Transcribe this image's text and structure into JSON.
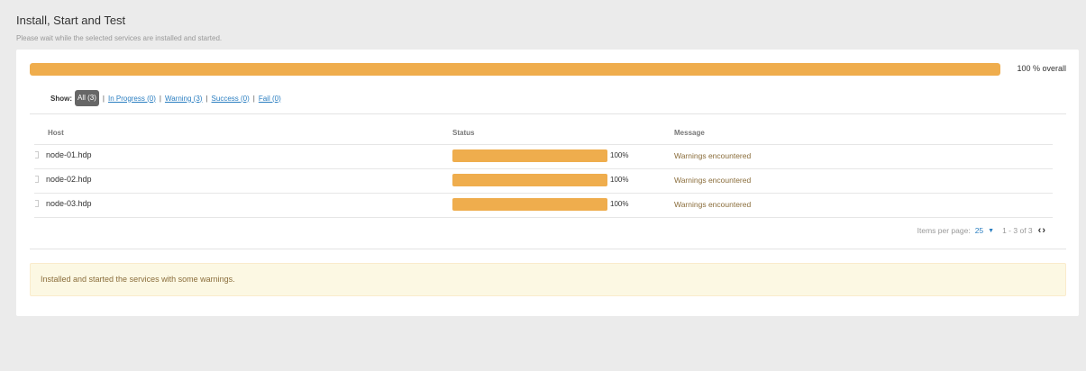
{
  "page": {
    "title": "Install, Start and Test",
    "subtitle": "Please wait while the selected services are installed and started."
  },
  "overall": {
    "progress_percent": 100,
    "label": "100 % overall"
  },
  "filters": {
    "show_label": "Show:",
    "items": [
      {
        "label": "All (3)",
        "active": true
      },
      {
        "label": "In Progress (0)",
        "active": false
      },
      {
        "label": "Warning (3)",
        "active": false
      },
      {
        "label": "Success (0)",
        "active": false
      },
      {
        "label": "Fail (0)",
        "active": false
      }
    ],
    "separator": "|"
  },
  "table": {
    "columns": [
      "Host",
      "Status",
      "Message"
    ],
    "rows": [
      {
        "host": "node-01.hdp",
        "progress": 100,
        "progress_label": "100%",
        "message": "Warnings encountered"
      },
      {
        "host": "node-02.hdp",
        "progress": 100,
        "progress_label": "100%",
        "message": "Warnings encountered"
      },
      {
        "host": "node-03.hdp",
        "progress": 100,
        "progress_label": "100%",
        "message": "Warnings encountered"
      }
    ]
  },
  "pagination": {
    "per_page_label": "Items per page:",
    "per_page_value": "25",
    "range": "1 - 3 of 3",
    "nav_icons": "chevron-left-right-icons"
  },
  "alert": {
    "text": "Installed and started the services with some warnings.",
    "type": "warning"
  },
  "colors": {
    "progress_warning": "#efad4d",
    "link": "#2a7ec1",
    "alert_bg": "#fcf8e3",
    "alert_text": "#8a6d3b"
  }
}
